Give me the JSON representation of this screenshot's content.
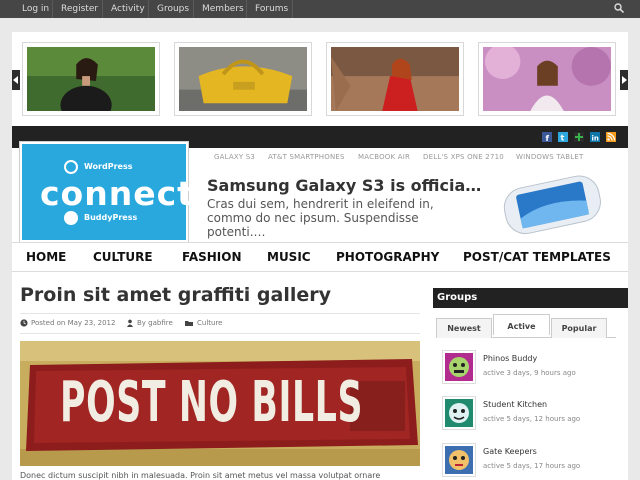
{
  "adminbar": {
    "items": [
      "Log in",
      "Register",
      "Activity",
      "Groups",
      "Members",
      "Forums"
    ],
    "search_icon": "search-icon"
  },
  "slider": {
    "slide_count": 4,
    "prev_icon": "chevron-left-icon",
    "next_icon": "chevron-right-icon"
  },
  "social": [
    "facebook-icon",
    "twitter-icon",
    "google-plus-icon",
    "linkedin-icon",
    "rss-icon"
  ],
  "logo": {
    "top_label": "WordPress",
    "word": "connect",
    "bottom_label": "BuddyPress"
  },
  "tags": [
    "GALAXY S3",
    "AT&T SMARTPHONES",
    "MACBOOK AIR",
    "DELL'S XPS ONE 2710",
    "WINDOWS TABLET"
  ],
  "featured": {
    "title": "Samsung Galaxy S3 is officia…",
    "excerpt": "Cras dui sem, hendrerit in eleifend in, commo do nec ipsum. Suspendisse potenti.…"
  },
  "nav": [
    "HOME",
    "CULTURE",
    "FASHION",
    "MUSIC",
    "PHOTOGRAPHY",
    "POST/CAT TEMPLATES"
  ],
  "post": {
    "title": "Proin sit amet graffiti gallery",
    "date": "Posted on May 23, 2012",
    "author": "By gabfire",
    "category": "Culture",
    "image_text": "POST NO BILLS",
    "excerpt": "Donec dictum suscipit nibh in malesuada. Proin sit amet metus vel massa volutpat ornare"
  },
  "sidebar": {
    "heading": "Groups",
    "tabs": [
      "Newest",
      "Active",
      "Popular"
    ],
    "active_tab": "Active",
    "groups": [
      {
        "name": "Phinos Buddy",
        "activity": "active 3 days, 9 hours ago"
      },
      {
        "name": "Student Kitchen",
        "activity": "active 5 days, 12 hours ago"
      },
      {
        "name": "Gate Keepers",
        "activity": "active 5 days, 17 hours ago"
      }
    ]
  },
  "colors": {
    "adminbar": "#464646",
    "logo_blue": "#29a8de",
    "strip": "#222222"
  }
}
